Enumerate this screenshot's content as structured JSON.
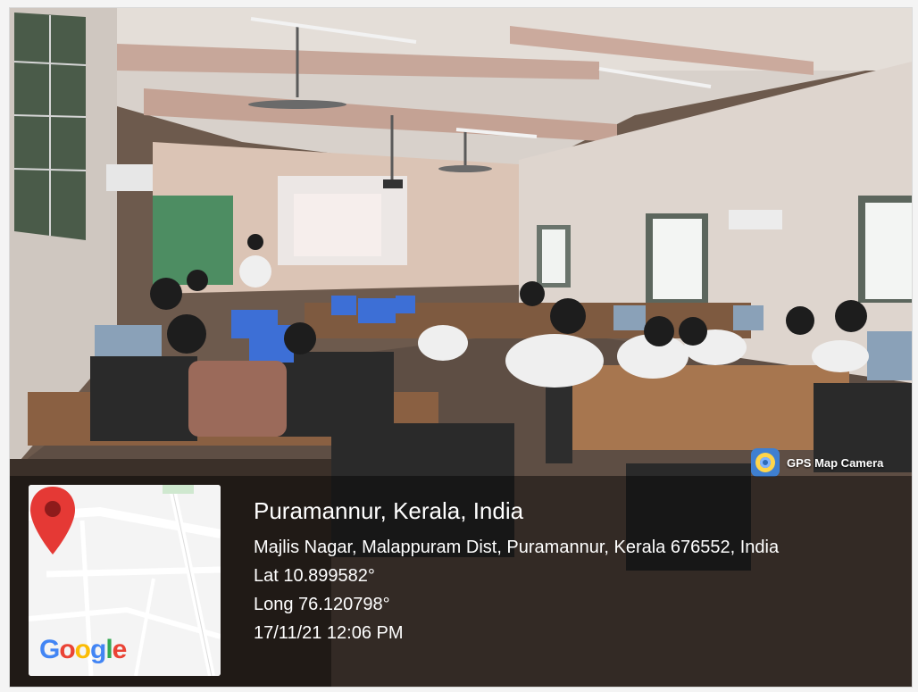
{
  "badge": {
    "label": "GPS Map Camera",
    "icon": "camera-pin-icon",
    "color": "#3f7fd0"
  },
  "location": {
    "title": "Puramannur, Kerala, India",
    "address": "Majlis Nagar, Malappuram Dist, Puramannur, Kerala 676552, India",
    "latitude": "Lat 10.899582°",
    "longitude": "Long 76.120798°",
    "datetime": "17/11/21 12:06 PM"
  },
  "map": {
    "brand": "Google",
    "pin_color": "#e53935",
    "icon": "map-pin-icon"
  }
}
